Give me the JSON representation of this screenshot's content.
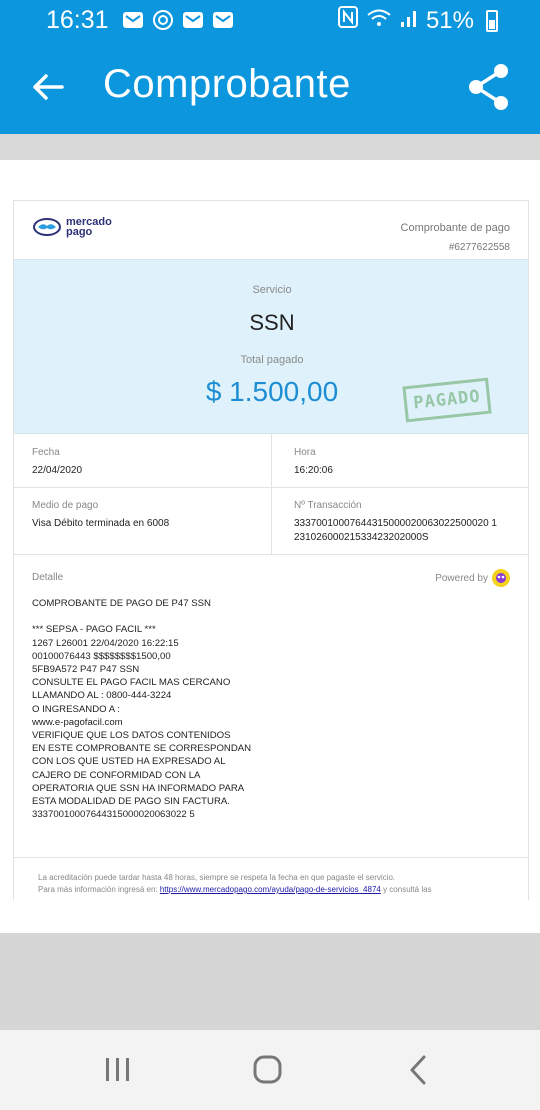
{
  "status_bar": {
    "time": "16:31",
    "battery": "51%",
    "notification_icons": [
      "mail-icon",
      "sync-icon",
      "mail-icon",
      "mail-icon"
    ],
    "system_icons": [
      "nfc-icon",
      "wifi-icon",
      "signal-icon",
      "battery-icon"
    ]
  },
  "app_bar": {
    "title": "Comprobante",
    "back_icon": "arrow-left-icon",
    "share_icon": "share-icon",
    "color": "#0b96dd"
  },
  "receipt": {
    "brand": {
      "line1": "mercado",
      "line2": "pago"
    },
    "type": "Comprobante de pago",
    "number": "#6277622558",
    "service_label": "Servicio",
    "service_name": "SSN",
    "total_label": "Total pagado",
    "total_amount": "$ 1.500,00",
    "stamp": "PAGADO",
    "fields": {
      "fecha_label": "Fecha",
      "fecha_value": "22/04/2020",
      "hora_label": "Hora",
      "hora_value": "16:20:06",
      "medio_label": "Medio de pago",
      "medio_value": "Visa Débito terminada en 6008",
      "transaccion_label": "Nº Transacción",
      "transaccion_value_line1": "33370010007644315000020063022500020 1",
      "transaccion_value_line2": "23102600021533423202000S"
    },
    "detail_label": "Detalle",
    "powered_by": "Powered by",
    "detail_text": "COMPROBANTE DE PAGO DE P47 SSN\n\n*** SEPSA - PAGO FACIL ***\n1267 L26001 22/04/2020 16:22:15\n00100076443 $$$$$$$$1500,00\n5FB9A572 P47 P47 SSN\nCONSULTE EL PAGO FACIL MAS CERCANO\nLLAMANDO AL : 0800-444-3224\nO INGRESANDO A :\nwww.e-pagofacil.com\nVERIFIQUE QUE LOS DATOS CONTENIDOS\nEN ESTE COMPROBANTE SE CORRESPONDAN\nCON LOS QUE USTED HA EXPRESADO AL\nCAJERO DE CONFORMIDAD CON LA\nOPERATORIA QUE SSN HA INFORMADO PARA\nESTA MODALIDAD DE PAGO SIN FACTURA.\n33370010007644315000020063022 5",
    "footer_line1": "La acreditación puede tardar hasta 48 horas, siempre se respeta la fecha en que pagaste el servicio.",
    "footer_line2_prefix": "Para más información ingresá en: ",
    "footer_link": "https://www.mercadopago.com/ayuda/pago-de-servicios_4874",
    "footer_line2_suffix": " y consultá las"
  },
  "nav_bar": {
    "recents_icon": "recent-apps-icon",
    "home_icon": "home-icon",
    "back_icon": "back-chevron-icon"
  }
}
